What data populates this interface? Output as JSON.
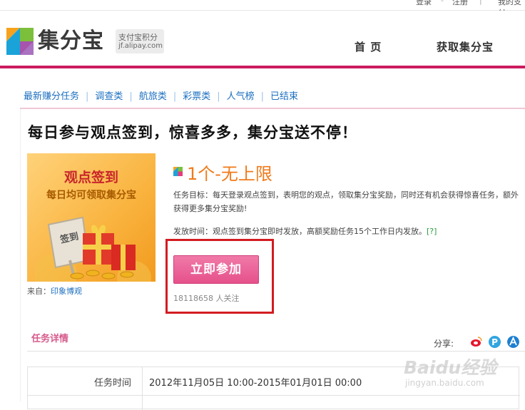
{
  "topbar": {
    "login": "登录",
    "register": "注册",
    "my_alipay": "我的支付"
  },
  "header": {
    "logo_text": "集分宝",
    "logo_sub_1": "支付宝积分",
    "logo_sub_2": "jf.alipay.com",
    "nav": [
      "首 页",
      "获取集分宝"
    ]
  },
  "categories": [
    "最新赚分任务",
    "调查类",
    "航旅类",
    "彩票类",
    "人气榜",
    "已结束"
  ],
  "task": {
    "headline": "每日参与观点签到，惊喜多多，集分宝送不停！",
    "promo_title": "观点签到",
    "promo_subtitle": "每日均可领取集分宝",
    "promo_tag": "签到",
    "source_label": "来自：",
    "source_link": "印象博观",
    "reward": "1个-无上限",
    "description": "任务目标：每天登录观点签到，表明您的观点，领取集分宝奖励，同时还有机会获得惊喜任务，额外获得更多集分宝奖励!",
    "time_label": "发放时间：观点签到集分宝即时发放，高额奖励任务15个工作日内发放。",
    "time_help": "[?]",
    "join_button": "立即参加",
    "followers": "18118658 人关注"
  },
  "details": {
    "title": "任务详情",
    "share_label": "分享:",
    "share_icons": [
      "weibo-icon",
      "qzone-icon",
      "alipay-icon"
    ],
    "rows": [
      {
        "key": "任务时间",
        "value": "2012年11月05日  10:00-2015年01月01日  00:00"
      }
    ]
  },
  "watermark": {
    "line1": "Baidu经验",
    "line2": "jingyan.baidu.com"
  },
  "colors": {
    "brand_pink": "#cc1c5f",
    "link_blue": "#1b6fc0",
    "reward_orange": "#f07a1a",
    "button_pink": "#e6518b",
    "highlight_red": "#d21c22"
  }
}
